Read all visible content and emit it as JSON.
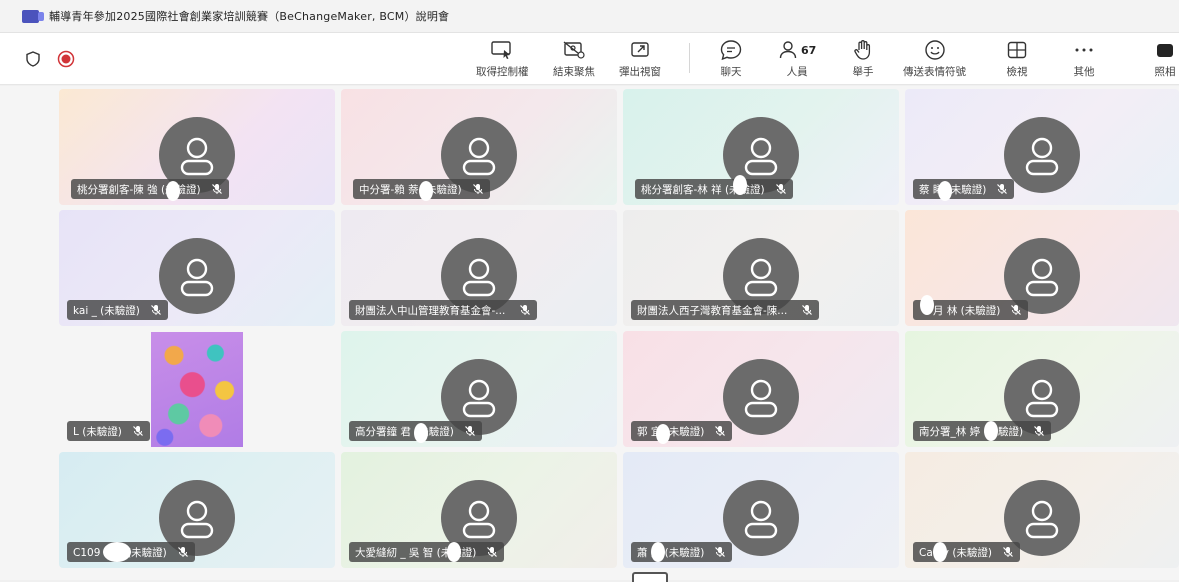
{
  "window": {
    "title": "輔導青年參加2025國際社會創業家培訓競賽（BeChangeMaker, BCM）說明會"
  },
  "toolbar": {
    "items": [
      {
        "label": "取得控制權",
        "icon": "take-control-icon"
      },
      {
        "label": "結束聚焦",
        "icon": "stop-spotlight-icon"
      },
      {
        "label": "彈出視窗",
        "icon": "pop-out-icon"
      },
      {
        "label": "聊天",
        "icon": "chat-icon"
      },
      {
        "label": "人員",
        "icon": "people-icon",
        "count": "67"
      },
      {
        "label": "舉手",
        "icon": "raise-hand-icon"
      },
      {
        "label": "傳送表情符號",
        "icon": "emoji-icon"
      },
      {
        "label": "檢視",
        "icon": "view-icon"
      },
      {
        "label": "其他",
        "icon": "more-icon"
      },
      {
        "label": "照相",
        "icon": "camera-icon"
      }
    ]
  },
  "participants": [
    {
      "name": "桃分署創客-陳 強 (未驗證)"
    },
    {
      "name": "中分署-賴 萘 (未驗證)"
    },
    {
      "name": "桃分署創客-林 祥 (未驗證)"
    },
    {
      "name": "蔡 睎 (未驗證)"
    },
    {
      "name": "kai _ (未驗證)"
    },
    {
      "name": "財團法人中山管理教育基金會-..."
    },
    {
      "name": "財團法人西子灣教育基金會-陳..."
    },
    {
      "name": "月 林 (未驗證)"
    },
    {
      "name": "L (未驗證)"
    },
    {
      "name": "高分署鐘 君 (未驗證)"
    },
    {
      "name": "郭 宜 (未驗證)"
    },
    {
      "name": "南分署_林 婷 (未驗證)"
    },
    {
      "name": "C109 233 (未驗證)"
    },
    {
      "name": "大愛縫紉 _ 吳 智 (未驗證)"
    },
    {
      "name": "蕭 元 (未驗證)"
    },
    {
      "name": "Ca dy (未驗證)"
    }
  ],
  "colors": {
    "accent": "#4b53bc",
    "record": "#d13438",
    "avatar": "#6b6b6b",
    "nametag": "#464646"
  }
}
